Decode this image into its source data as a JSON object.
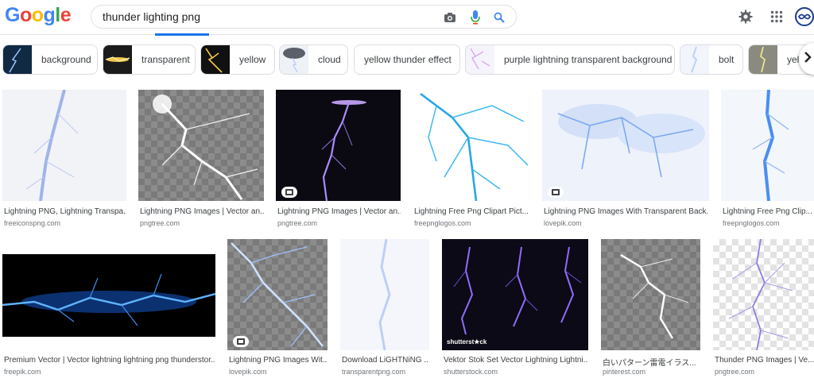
{
  "logo": {
    "letters": [
      "G",
      "o",
      "o",
      "g",
      "l",
      "e"
    ],
    "colors": [
      "#4285f4",
      "#ea4335",
      "#fbbc05",
      "#4285f4",
      "#34a853",
      "#ea4335"
    ]
  },
  "search": {
    "query": "thunder lighting png",
    "camera_icon": "camera-icon",
    "mic_icon": "mic-icon",
    "search_icon": "search-icon"
  },
  "header_icons": {
    "settings": "gear-icon",
    "apps": "apps-grid-icon",
    "account": "account-avatar-icon"
  },
  "chips": [
    {
      "label": "background"
    },
    {
      "label": "transparent"
    },
    {
      "label": "yellow"
    },
    {
      "label": "cloud"
    },
    {
      "label": "yellow thunder effect"
    },
    {
      "label": "purple lightning transparent background"
    },
    {
      "label": "bolt"
    },
    {
      "label": "yello"
    }
  ],
  "results": [
    {
      "title": "Lightning PNG, Lightning Transpa...",
      "source": "freeiconspng.com"
    },
    {
      "title": "Lightning PNG Images | Vector an...",
      "source": "pngtree.com"
    },
    {
      "title": "Lightning PNG Images | Vector an...",
      "source": "pngtree.com"
    },
    {
      "title": "Lightning Free Png Clipart Pict...",
      "source": "freepnglogos.com"
    },
    {
      "title": "Lightning PNG Images With Transparent Back...",
      "source": "lovepik.com"
    },
    {
      "title": "Lightning Free Png Clip...",
      "source": "freepnglogos.com"
    },
    {
      "title": "Premium Vector | Vector lightning lightning png thunderstor...",
      "source": "freepik.com"
    },
    {
      "title": "Lightning PNG Images Wit...",
      "source": "lovepik.com"
    },
    {
      "title": "Download LiGHTNiNG ...",
      "source": "transparentpng.com"
    },
    {
      "title": "Vektor Stok Set Vector Lightning Lightni...",
      "source": "shutterstock.com",
      "watermark": "shutterst★ck"
    },
    {
      "title": "白いパターン雷電イラス...",
      "source": "pinterest.com"
    },
    {
      "title": "Thunder PNG Images | Ve...",
      "source": "pngtree.com"
    }
  ]
}
